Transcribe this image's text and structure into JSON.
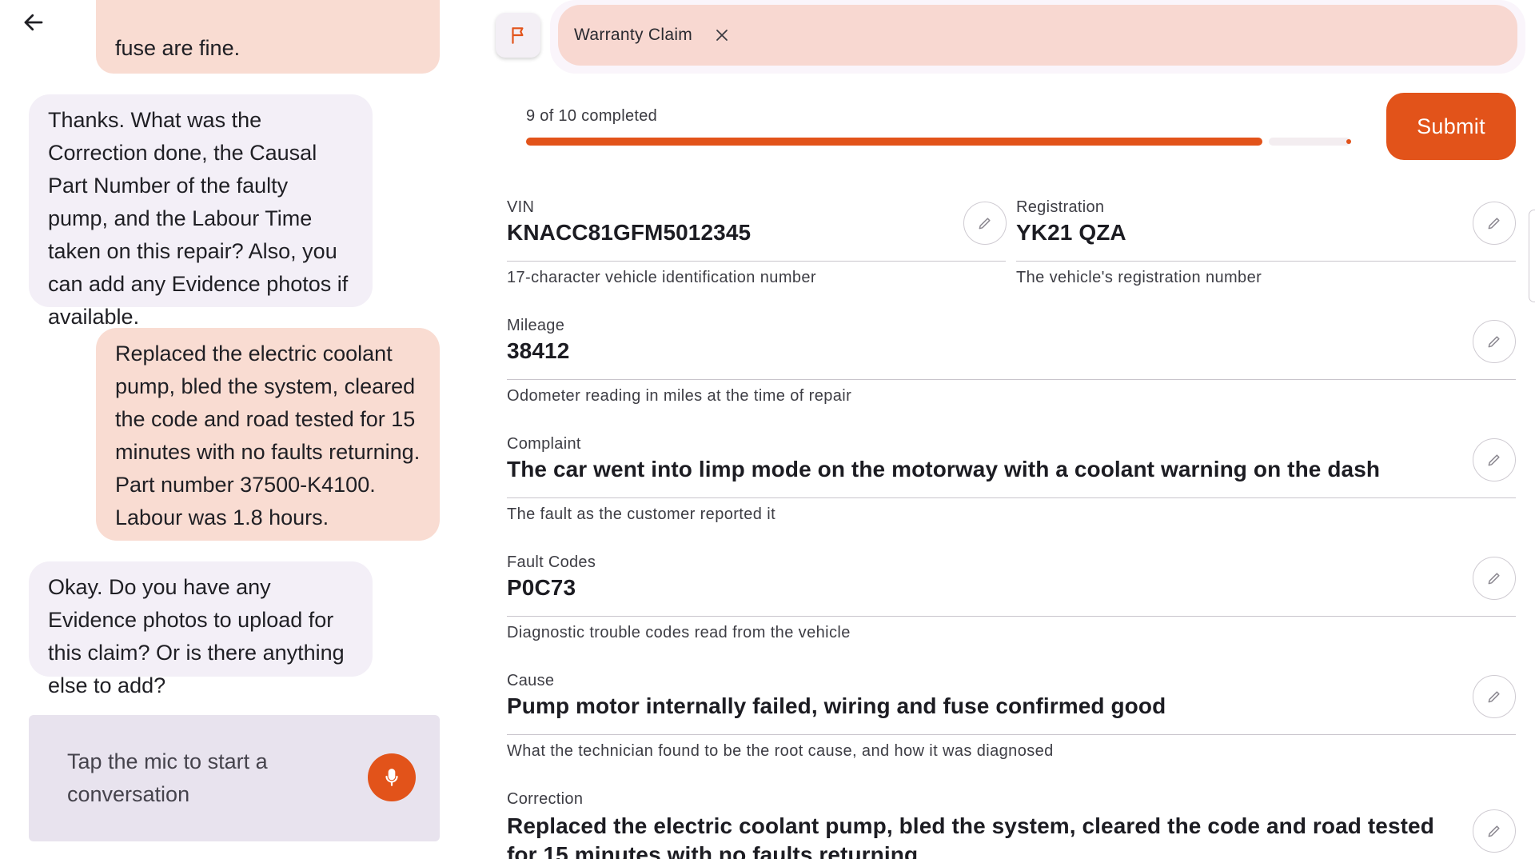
{
  "chat": {
    "messages": [
      {
        "role": "user",
        "text": "fuse are fine."
      },
      {
        "role": "assistant",
        "text": "Thanks. What was the Correction done, the Causal Part Number of the faulty pump, and the Labour Time taken on this repair? Also, you can add any Evidence photos if available."
      },
      {
        "role": "user",
        "text": "Replaced the electric coolant pump, bled the system, cleared the code and road tested for 15 minutes with no faults returning. Part number 37500-K4100. Labour was 1.8 hours."
      },
      {
        "role": "assistant",
        "text": "Okay. Do you have any Evidence photos to upload for this claim? Or is there anything else to add?"
      }
    ],
    "composer_hint": "Tap the mic to start a conversation"
  },
  "tab": {
    "label": "Warranty Claim"
  },
  "progress": {
    "text": "9 of 10 completed",
    "completed": 9,
    "total": 10
  },
  "submit_label": "Submit",
  "fields": {
    "vin": {
      "label": "VIN",
      "value": "KNACC81GFM5012345",
      "help": "17-character vehicle identification number"
    },
    "registration": {
      "label": "Registration",
      "value": "YK21 QZA",
      "help": "The vehicle's registration number"
    },
    "mileage": {
      "label": "Mileage",
      "value": "38412",
      "help": "Odometer reading in miles at the time of repair"
    },
    "complaint": {
      "label": "Complaint",
      "value": "The car went into limp mode on the motorway with a coolant warning on the dash",
      "help": "The fault as the customer reported it"
    },
    "fault_codes": {
      "label": "Fault Codes",
      "value": "P0C73",
      "help": "Diagnostic trouble codes read from the vehicle"
    },
    "cause": {
      "label": "Cause",
      "value": "Pump motor internally failed, wiring and fuse confirmed good",
      "help": "What the technician found to be the root cause, and how it was diagnosed"
    },
    "correction": {
      "label": "Correction",
      "value": "Replaced the electric coolant pump, bled the system, cleared the code and road tested for 15 minutes with no faults returning"
    }
  },
  "colors": {
    "accent": "#e2531a",
    "user_bubble": "#f9dcd2",
    "assistant_bubble": "#f3eff7",
    "tab": "#f8d8d1"
  },
  "icons": {
    "back": "arrow-left-icon",
    "flag": "flag-icon",
    "close": "close-icon",
    "mic": "mic-icon",
    "edit": "pencil-icon"
  }
}
